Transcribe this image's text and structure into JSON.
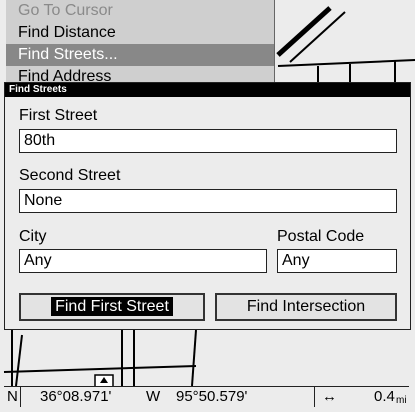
{
  "menu": {
    "items": [
      {
        "label": "Go To Cursor"
      },
      {
        "label": "Find Distance"
      },
      {
        "label": "Find Streets..."
      },
      {
        "label": "Find Address"
      }
    ]
  },
  "dialog": {
    "title": "Find Streets",
    "first_street": {
      "label": "First Street",
      "value": "80th"
    },
    "second_street": {
      "label": "Second Street",
      "value": "None"
    },
    "city": {
      "label": "City",
      "value": "Any"
    },
    "postal_code": {
      "label": "Postal Code",
      "value": "Any"
    },
    "buttons": {
      "find_first": "Find First Street",
      "find_intersection": "Find Intersection"
    }
  },
  "status": {
    "lat_hemi": "N",
    "lat": "36°08.971'",
    "lon_hemi": "W",
    "lon": "95°50.579'",
    "scale_icon": "↔",
    "scale": "0.4",
    "scale_unit": "mi"
  }
}
